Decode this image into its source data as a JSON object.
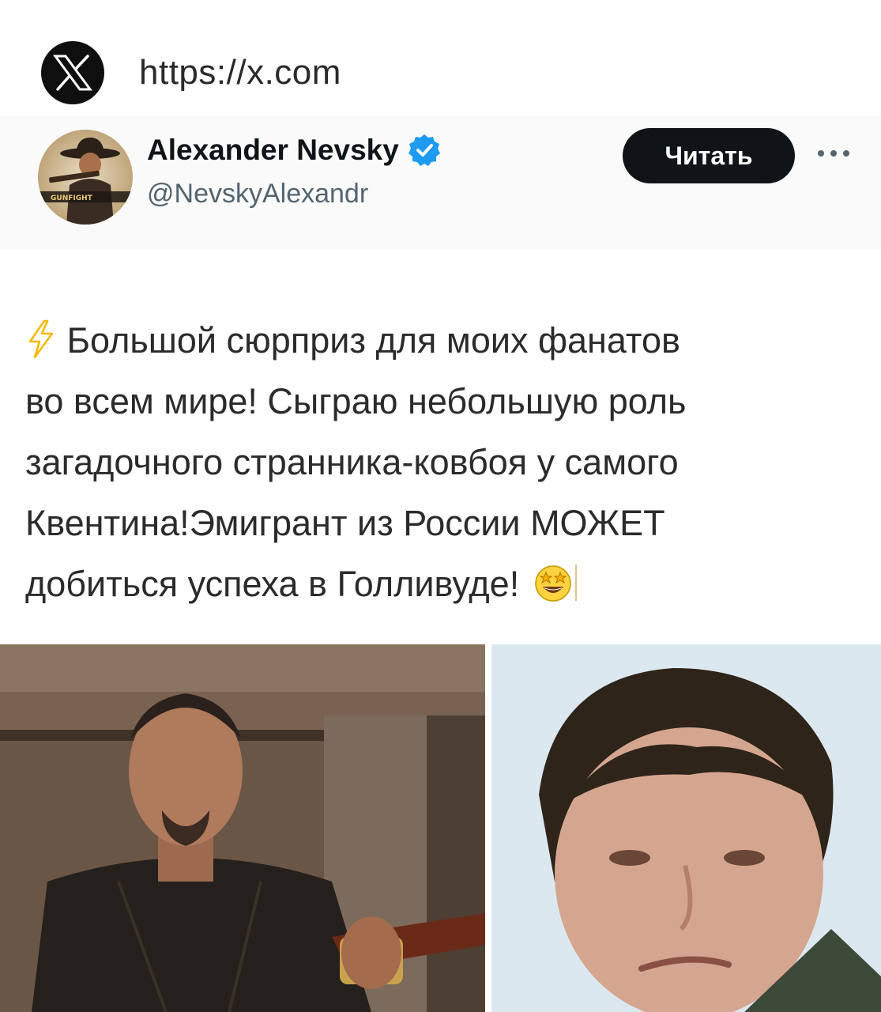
{
  "browser": {
    "url": "https://x.com",
    "logo_icon": "x-logo-icon"
  },
  "profile": {
    "display_name": "Alexander Nevsky",
    "handle": "@NevskyAlexandr",
    "verified_icon": "verified-badge-icon",
    "avatar_caption": "GUNFIGHT",
    "follow_label": "Читать",
    "more_icon": "more-horizontal-icon"
  },
  "tweet": {
    "lead_icon": "lightning-emoji-icon",
    "trail_icon": "star-struck-emoji-icon",
    "lines": [
      "Большой сюрприз для моих фанатов",
      "во всем мире! Сыграю небольшую роль",
      "загадочного странника-ковбоя у самого",
      "Квентина!Эмигрант из России МОЖЕТ",
      "добиться успеха в Голливуде!"
    ]
  },
  "media": {
    "left_photo": "photo-man-with-rifle",
    "right_photo": "photo-man-portrait"
  },
  "colors": {
    "accent_verified": "#1d9bf0",
    "follow_bg": "#0f1419",
    "handle_text": "#536471",
    "lightning": "#f5b800"
  }
}
